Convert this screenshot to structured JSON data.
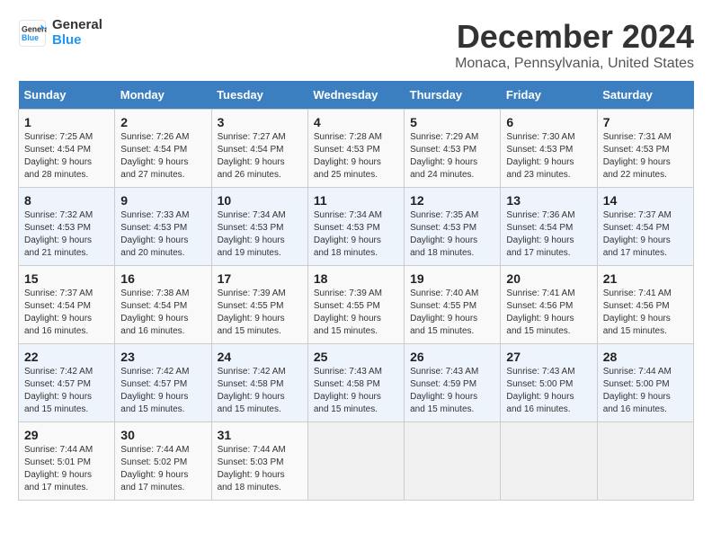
{
  "logo": {
    "line1": "General",
    "line2": "Blue"
  },
  "title": {
    "month_year": "December 2024",
    "location": "Monaca, Pennsylvania, United States"
  },
  "calendar": {
    "headers": [
      "Sunday",
      "Monday",
      "Tuesday",
      "Wednesday",
      "Thursday",
      "Friday",
      "Saturday"
    ],
    "weeks": [
      [
        {
          "day": "1",
          "info": "Sunrise: 7:25 AM\nSunset: 4:54 PM\nDaylight: 9 hours\nand 28 minutes."
        },
        {
          "day": "2",
          "info": "Sunrise: 7:26 AM\nSunset: 4:54 PM\nDaylight: 9 hours\nand 27 minutes."
        },
        {
          "day": "3",
          "info": "Sunrise: 7:27 AM\nSunset: 4:54 PM\nDaylight: 9 hours\nand 26 minutes."
        },
        {
          "day": "4",
          "info": "Sunrise: 7:28 AM\nSunset: 4:53 PM\nDaylight: 9 hours\nand 25 minutes."
        },
        {
          "day": "5",
          "info": "Sunrise: 7:29 AM\nSunset: 4:53 PM\nDaylight: 9 hours\nand 24 minutes."
        },
        {
          "day": "6",
          "info": "Sunrise: 7:30 AM\nSunset: 4:53 PM\nDaylight: 9 hours\nand 23 minutes."
        },
        {
          "day": "7",
          "info": "Sunrise: 7:31 AM\nSunset: 4:53 PM\nDaylight: 9 hours\nand 22 minutes."
        }
      ],
      [
        {
          "day": "8",
          "info": "Sunrise: 7:32 AM\nSunset: 4:53 PM\nDaylight: 9 hours\nand 21 minutes."
        },
        {
          "day": "9",
          "info": "Sunrise: 7:33 AM\nSunset: 4:53 PM\nDaylight: 9 hours\nand 20 minutes."
        },
        {
          "day": "10",
          "info": "Sunrise: 7:34 AM\nSunset: 4:53 PM\nDaylight: 9 hours\nand 19 minutes."
        },
        {
          "day": "11",
          "info": "Sunrise: 7:34 AM\nSunset: 4:53 PM\nDaylight: 9 hours\nand 18 minutes."
        },
        {
          "day": "12",
          "info": "Sunrise: 7:35 AM\nSunset: 4:53 PM\nDaylight: 9 hours\nand 18 minutes."
        },
        {
          "day": "13",
          "info": "Sunrise: 7:36 AM\nSunset: 4:54 PM\nDaylight: 9 hours\nand 17 minutes."
        },
        {
          "day": "14",
          "info": "Sunrise: 7:37 AM\nSunset: 4:54 PM\nDaylight: 9 hours\nand 17 minutes."
        }
      ],
      [
        {
          "day": "15",
          "info": "Sunrise: 7:37 AM\nSunset: 4:54 PM\nDaylight: 9 hours\nand 16 minutes."
        },
        {
          "day": "16",
          "info": "Sunrise: 7:38 AM\nSunset: 4:54 PM\nDaylight: 9 hours\nand 16 minutes."
        },
        {
          "day": "17",
          "info": "Sunrise: 7:39 AM\nSunset: 4:55 PM\nDaylight: 9 hours\nand 15 minutes."
        },
        {
          "day": "18",
          "info": "Sunrise: 7:39 AM\nSunset: 4:55 PM\nDaylight: 9 hours\nand 15 minutes."
        },
        {
          "day": "19",
          "info": "Sunrise: 7:40 AM\nSunset: 4:55 PM\nDaylight: 9 hours\nand 15 minutes."
        },
        {
          "day": "20",
          "info": "Sunrise: 7:41 AM\nSunset: 4:56 PM\nDaylight: 9 hours\nand 15 minutes."
        },
        {
          "day": "21",
          "info": "Sunrise: 7:41 AM\nSunset: 4:56 PM\nDaylight: 9 hours\nand 15 minutes."
        }
      ],
      [
        {
          "day": "22",
          "info": "Sunrise: 7:42 AM\nSunset: 4:57 PM\nDaylight: 9 hours\nand 15 minutes."
        },
        {
          "day": "23",
          "info": "Sunrise: 7:42 AM\nSunset: 4:57 PM\nDaylight: 9 hours\nand 15 minutes."
        },
        {
          "day": "24",
          "info": "Sunrise: 7:42 AM\nSunset: 4:58 PM\nDaylight: 9 hours\nand 15 minutes."
        },
        {
          "day": "25",
          "info": "Sunrise: 7:43 AM\nSunset: 4:58 PM\nDaylight: 9 hours\nand 15 minutes."
        },
        {
          "day": "26",
          "info": "Sunrise: 7:43 AM\nSunset: 4:59 PM\nDaylight: 9 hours\nand 15 minutes."
        },
        {
          "day": "27",
          "info": "Sunrise: 7:43 AM\nSunset: 5:00 PM\nDaylight: 9 hours\nand 16 minutes."
        },
        {
          "day": "28",
          "info": "Sunrise: 7:44 AM\nSunset: 5:00 PM\nDaylight: 9 hours\nand 16 minutes."
        }
      ],
      [
        {
          "day": "29",
          "info": "Sunrise: 7:44 AM\nSunset: 5:01 PM\nDaylight: 9 hours\nand 17 minutes."
        },
        {
          "day": "30",
          "info": "Sunrise: 7:44 AM\nSunset: 5:02 PM\nDaylight: 9 hours\nand 17 minutes."
        },
        {
          "day": "31",
          "info": "Sunrise: 7:44 AM\nSunset: 5:03 PM\nDaylight: 9 hours\nand 18 minutes."
        },
        {
          "day": "",
          "info": ""
        },
        {
          "day": "",
          "info": ""
        },
        {
          "day": "",
          "info": ""
        },
        {
          "day": "",
          "info": ""
        }
      ]
    ]
  }
}
